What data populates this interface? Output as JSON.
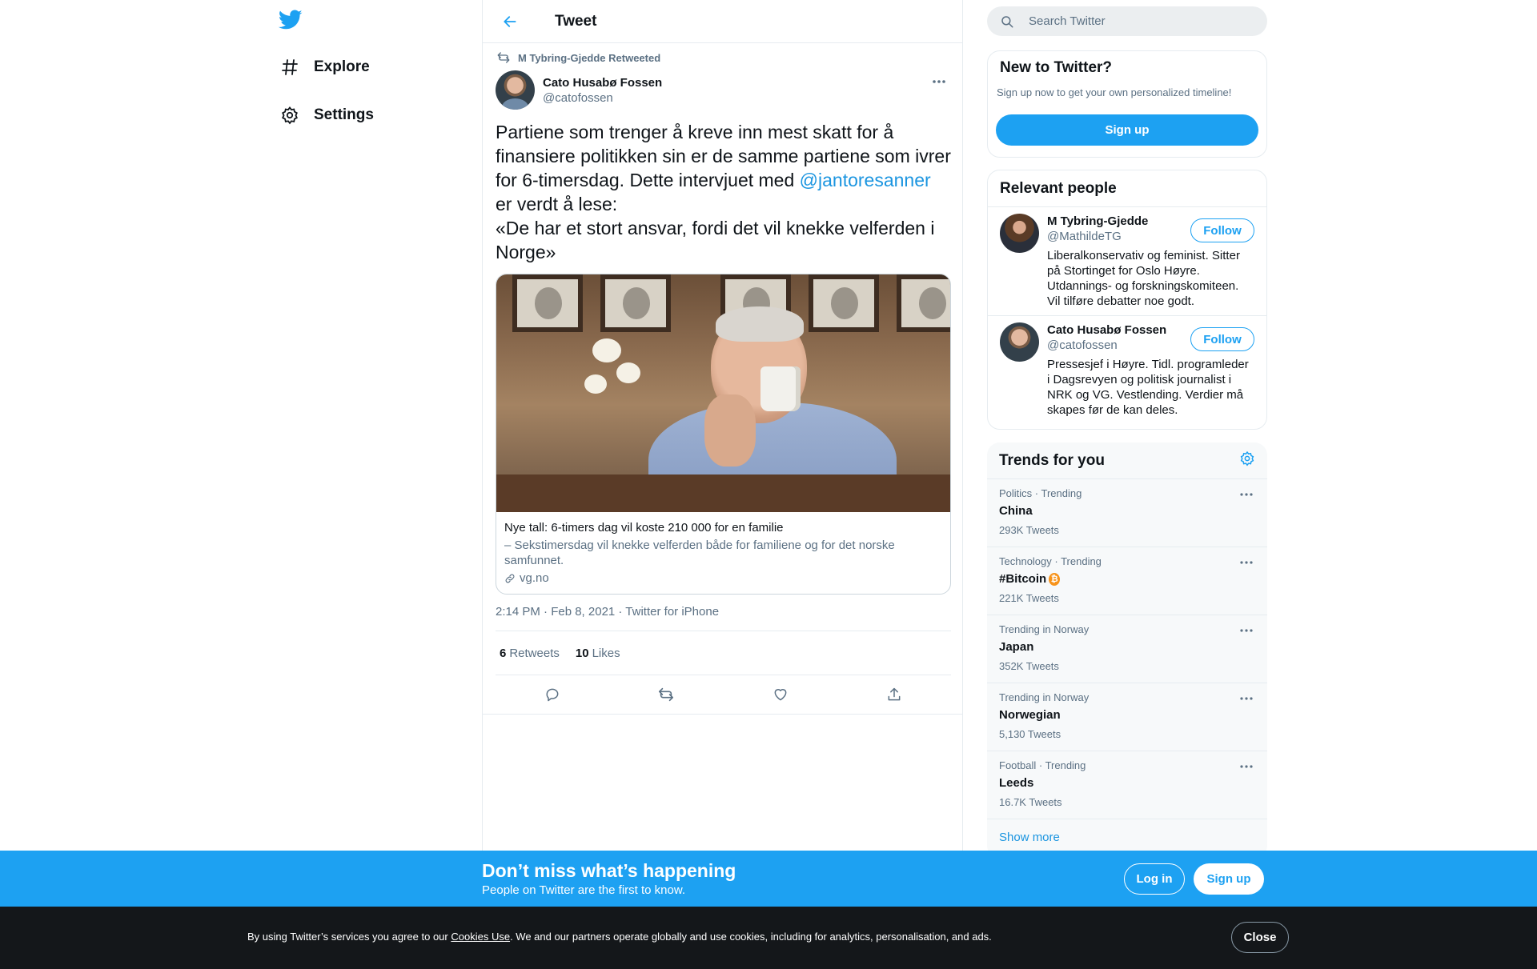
{
  "nav": {
    "items": [
      {
        "label": "Explore",
        "icon": "hashtag-icon"
      },
      {
        "label": "Settings",
        "icon": "gear-icon"
      }
    ]
  },
  "header": {
    "title": "Tweet"
  },
  "tweet": {
    "retweeted_by": "M Tybring-Gjedde Retweeted",
    "author_name": "Cato Husabø Fossen",
    "author_handle": "@catofossen",
    "text_before": "Partiene som trenger å kreve inn mest skatt for å finansiere politikken sin er de samme partiene som ivrer for 6-timersdag. Dette intervjuet med ",
    "mention": "@jantoresanner",
    "text_after": " er verdt å lese:",
    "quote": "«De har et stort ansvar, fordi det vil knekke velferden i Norge»",
    "card": {
      "title": "Nye tall: 6-timers dag vil koste 210 000 for en familie",
      "description": "– Sekstimersdag vil knekke velferden både for familiene og for det norske samfunnet.",
      "domain": "vg.no"
    },
    "meta": "2:14 PM · Feb 8, 2021 · Twitter for iPhone",
    "retweets_count": "6",
    "retweets_label": "Retweets",
    "likes_count": "10",
    "likes_label": "Likes"
  },
  "search": {
    "placeholder": "Search Twitter"
  },
  "new_to_twitter": {
    "title": "New to Twitter?",
    "subtitle": "Sign up now to get your own personalized timeline!",
    "signup_label": "Sign up"
  },
  "relevant_people": {
    "title": "Relevant people",
    "people": [
      {
        "name": "M Tybring-Gjedde",
        "handle": "@MathildeTG",
        "bio": "Liberalkonservativ og feminist. Sitter på Stortinget for Oslo Høyre. Utdannings- og forskningskomiteen. Vil tilføre debatter noe godt.",
        "follow_label": "Follow"
      },
      {
        "name": "Cato Husabø Fossen",
        "handle": "@catofossen",
        "bio": "Pressesjef i Høyre. Tidl. programleder i Dagsrevyen og politisk journalist i NRK og VG. Vestlending. Verdier må skapes før de kan deles.",
        "follow_label": "Follow"
      }
    ]
  },
  "trends": {
    "title": "Trends for you",
    "items": [
      {
        "context": "Politics · Trending",
        "name": "China",
        "count": "293K Tweets"
      },
      {
        "context": "Technology · Trending",
        "name": "#Bitcoin",
        "count": "221K Tweets"
      },
      {
        "context": "Trending in Norway",
        "name": "Japan",
        "count": "352K Tweets"
      },
      {
        "context": "Trending in Norway",
        "name": "Norwegian",
        "count": "5,130 Tweets"
      },
      {
        "context": "Football · Trending",
        "name": "Leeds",
        "count": "16.7K Tweets"
      }
    ],
    "show_more": "Show more"
  },
  "signup_banner": {
    "title": "Don’t miss what’s happening",
    "subtitle": "People on Twitter are the first to know.",
    "login_label": "Log in",
    "signup_label": "Sign up"
  },
  "cookie": {
    "text_before": "By using Twitter’s services you agree to our ",
    "link": "Cookies Use",
    "text_after": ". We and our partners operate globally and use cookies, including for analytics, personalisation, and ads.",
    "close_label": "Close"
  },
  "colors": {
    "accent": "#1da1f2",
    "link": "#1b95e0",
    "muted": "#5b7083",
    "cookie_bg": "#14171a"
  }
}
